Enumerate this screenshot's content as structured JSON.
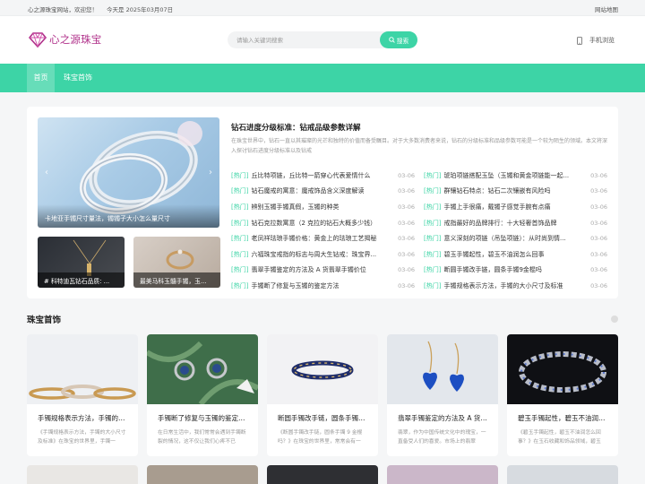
{
  "topbar": {
    "welcome": "心之源珠宝网站，欢迎您！",
    "date": "今天是 2025年03月07日",
    "sitemap": "网站地图"
  },
  "header": {
    "logo_text": "心之源珠宝",
    "search_placeholder": "请输入关键词搜索",
    "search_button": "搜索",
    "mobile_label": "手机浏览"
  },
  "nav": {
    "items": [
      {
        "label": "首页",
        "active": true
      },
      {
        "label": "珠宝首饰",
        "active": false
      }
    ]
  },
  "slider": {
    "caption": "卡地亚手镯尺寸量法，镯镯子大小怎么量尺寸",
    "prev_icon": "chevron-left-icon",
    "next_icon": "chevron-right-icon"
  },
  "thumbs": [
    {
      "caption": "# 科特迪瓦钻石品质: ..."
    },
    {
      "caption": "最美马科玉髓手镯，玉..."
    }
  ],
  "headline": {
    "title": "钻石进度分级标准：钻戒品级参数详解",
    "summary": "在珠宝世界中，钻石一直以其璀璨的光芒和独特的价值而备受瞩目。对于大多数消费者来说，钻石的分级标准和品级参数可能是一个较为陌生的领域。本文将深入探讨钻石进度分级标准以及钻戒"
  },
  "news_left": [
    {
      "tag": "[热门]",
      "title": "丘比特项链，丘比特一箭穿心代表爱情什么",
      "date": "03-06"
    },
    {
      "tag": "[热门]",
      "title": "钻石魔戒的寓意：魔戒饰品含义深度解读",
      "date": "03-06"
    },
    {
      "tag": "[热门]",
      "title": "辨别玉镯手镯真假，玉镯的种类",
      "date": "03-06"
    },
    {
      "tag": "[热门]",
      "title": "钻石克拉数寓意（2 克拉的钻石大概多少钱）",
      "date": "03-06"
    },
    {
      "tag": "[热门]",
      "title": "老凤祥珐琅手镯价格：黄金上的珐琅工艺揭秘",
      "date": "03-06"
    },
    {
      "tag": "[热门]",
      "title": "六福珠宝戒指的标志与周大生钻戒：珠宝界...",
      "date": "03-06"
    },
    {
      "tag": "[热门]",
      "title": "翡翠手镯鉴定的方法及 A 货翡翠手镯价位",
      "date": "03-06"
    },
    {
      "tag": "[热门]",
      "title": "手镯断了修复与玉镯的鉴定方法",
      "date": "03-06"
    }
  ],
  "news_right": [
    {
      "tag": "[热门]",
      "title": "琥珀项链搭配玉坠（玉镯和黄金项链能一起...",
      "date": "03-06"
    },
    {
      "tag": "[热门]",
      "title": "群镶钻石特点：钻石二次镶嵌有风险吗",
      "date": "03-06"
    },
    {
      "tag": "[热门]",
      "title": "手镯上手很痛，戴镯子感觉手腕有点痛",
      "date": "03-06"
    },
    {
      "tag": "[热门]",
      "title": "戒指最好的品牌排行：十大轻奢首饰品牌",
      "date": "03-06"
    },
    {
      "tag": "[热门]",
      "title": "意义深刻的项链（吊坠项链）：从时尚到情...",
      "date": "03-06"
    },
    {
      "tag": "[热门]",
      "title": "碧玉手镯起性，碧玉不油润怎么回事",
      "date": "03-06"
    },
    {
      "tag": "[热门]",
      "title": "断圆手镯改手链，圆条手镯9金棍吗",
      "date": "03-06"
    },
    {
      "tag": "[热门]",
      "title": "手镯规格表示方法，手镯的大小尺寸及标准",
      "date": "03-06"
    }
  ],
  "section": {
    "title": "珠宝首饰"
  },
  "cards": [
    {
      "title": "手镯规格表示方法，手镯的大小尺寸及标准",
      "desc": "《手镯规格表示方法，手镯的大小尺寸及标准》在珠宝的世界里，手镯一"
    },
    {
      "title": "手镯断了修复与玉镯的鉴定方法",
      "desc": "在日常生活中，我们常常会遇到手镯断裂的情况，这不仅让我们心疼不已"
    },
    {
      "title": "断圆手镯改手链，圆条手镯9金棍吗",
      "desc": "《断圆手镯改手链，圆条手镯 9 金棍吗？》在珠宝的世界里，常常会有一"
    },
    {
      "title": "翡翠手镯鉴定的方法及 A 货翡翠手镯价位",
      "desc": "翡翠，作为中国传统文化中的瑰宝，一直备受人们的喜爱。市场上的翡翠"
    },
    {
      "title": "碧玉手镯起性，碧玉不油润怎么回事",
      "desc": "《碧玉手镯起性，碧玉不油润怎么回事？》在玉石收藏和饰品领域，碧玉"
    }
  ]
}
